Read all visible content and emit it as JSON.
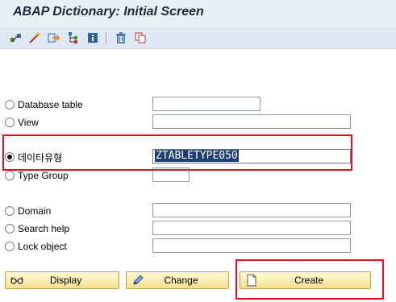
{
  "title": "ABAP Dictionary: Initial Screen",
  "toolbar": {
    "icons": [
      "where-used-icon",
      "magic-wand-icon",
      "jump-icon",
      "hierarchy-icon",
      "info-icon",
      "delete-icon",
      "copy-icon"
    ]
  },
  "options": [
    {
      "label": "Database table",
      "value": "",
      "selected": false
    },
    {
      "label": "View",
      "value": "",
      "selected": false
    },
    {
      "label": "데이타유형",
      "value": "ZTABLETYPE050",
      "selected": true
    },
    {
      "label": "Type Group",
      "value": "",
      "selected": false
    },
    {
      "label": "Domain",
      "value": "",
      "selected": false
    },
    {
      "label": "Search help",
      "value": "",
      "selected": false
    },
    {
      "label": "Lock object",
      "value": "",
      "selected": false
    }
  ],
  "buttons": {
    "display": "Display",
    "change": "Change",
    "create": "Create"
  },
  "colors": {
    "highlight": "#e0101e",
    "selection": "#1e3f75",
    "button_bg": "#f5e08a"
  }
}
